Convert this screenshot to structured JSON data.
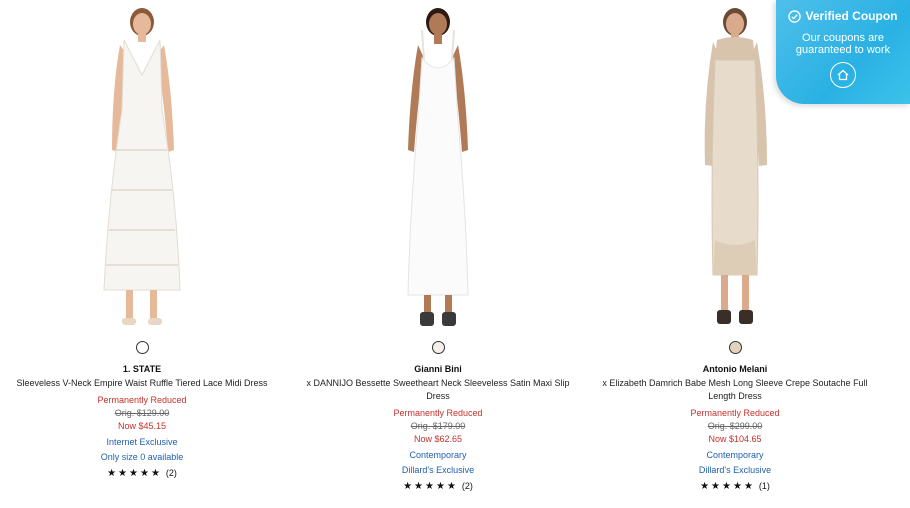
{
  "products": [
    {
      "brand": "1. STATE",
      "name": "Sleeveless V-Neck Empire Waist Ruffle Tiered Lace Midi Dress",
      "reduced_label": "Permanently Reduced",
      "orig_price": "Orig. $129.00",
      "now_price": "Now $45.15",
      "tags": [
        "Internet Exclusive",
        "Only size 0 available"
      ],
      "stars": "★★★★★",
      "review_count": "(2)",
      "swatch_color": "#ffffff"
    },
    {
      "brand": "Gianni Bini",
      "name": "x DANNIJO Bessette Sweetheart Neck Sleeveless Satin Maxi Slip Dress",
      "reduced_label": "Permanently Reduced",
      "orig_price": "Orig. $179.00",
      "now_price": "Now $62.65",
      "tags": [
        "Contemporary",
        "Dillard's Exclusive"
      ],
      "stars": "★★★★★",
      "review_count": "(2)",
      "swatch_color": "#f4f1ea"
    },
    {
      "brand": "Antonio Melani",
      "name": "x Elizabeth Damrich Babe Mesh Long Sleeve Crepe Soutache Full Length Dress",
      "reduced_label": "Permanently Reduced",
      "orig_price": "Orig. $299.00",
      "now_price": "Now $104.65",
      "tags": [
        "Contemporary",
        "Dillard's Exclusive"
      ],
      "stars": "★★★★★",
      "review_count": "(1)",
      "swatch_color": "#e2d3c0"
    }
  ],
  "coupon": {
    "title": "Verified Coupon",
    "subtitle_line1": "Our coupons are",
    "subtitle_line2": "guaranteed to work",
    "check_icon": "check-circle-icon",
    "logo_icon": "house-logo-icon",
    "bg_color": "#2ab1e4"
  }
}
